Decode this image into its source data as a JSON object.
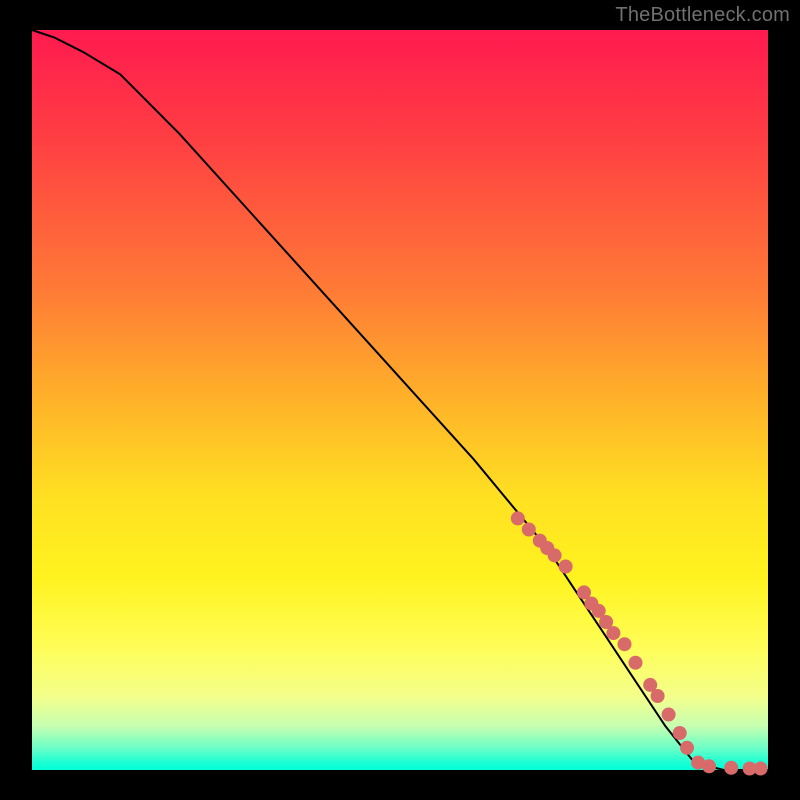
{
  "watermark": "TheBottleneck.com",
  "chart_data": {
    "type": "line",
    "title": "",
    "xlabel": "",
    "ylabel": "",
    "xlim": [
      0,
      100
    ],
    "ylim": [
      0,
      100
    ],
    "series": [
      {
        "name": "curve",
        "color": "#000000",
        "x": [
          0,
          3,
          7,
          12,
          20,
          30,
          40,
          50,
          60,
          65,
          70,
          74,
          78,
          82,
          86,
          90,
          94,
          98,
          100
        ],
        "y": [
          100,
          99,
          97,
          94,
          86,
          75,
          64,
          53,
          42,
          36,
          30,
          24,
          18,
          12,
          6,
          1,
          0,
          0,
          0
        ]
      }
    ],
    "markers": {
      "name": "highlight-dots",
      "color": "#d86a6a",
      "radius_px": 7,
      "x": [
        66,
        67.5,
        69,
        70,
        71,
        72.5,
        75,
        76,
        77,
        78,
        79,
        80.5,
        82,
        84,
        85,
        86.5,
        88,
        89,
        90.5,
        92,
        95,
        97.5,
        99
      ],
      "y": [
        34,
        32.5,
        31,
        30,
        29,
        27.5,
        24,
        22.5,
        21.5,
        20,
        18.5,
        17,
        14.5,
        11.5,
        10,
        7.5,
        5,
        3,
        1,
        0.5,
        0.3,
        0.2,
        0.2
      ]
    },
    "gradient_stops": [
      {
        "pos": 0.0,
        "color": "#ff1a4f"
      },
      {
        "pos": 0.15,
        "color": "#ff3f43"
      },
      {
        "pos": 0.35,
        "color": "#ff7a36"
      },
      {
        "pos": 0.5,
        "color": "#ffb229"
      },
      {
        "pos": 0.63,
        "color": "#ffe022"
      },
      {
        "pos": 0.74,
        "color": "#fff31f"
      },
      {
        "pos": 0.83,
        "color": "#fffd55"
      },
      {
        "pos": 0.9,
        "color": "#f4ff8a"
      },
      {
        "pos": 0.94,
        "color": "#c8ffb0"
      },
      {
        "pos": 0.97,
        "color": "#6dffc6"
      },
      {
        "pos": 0.99,
        "color": "#1affd4"
      },
      {
        "pos": 1.0,
        "color": "#00ffd6"
      }
    ]
  }
}
